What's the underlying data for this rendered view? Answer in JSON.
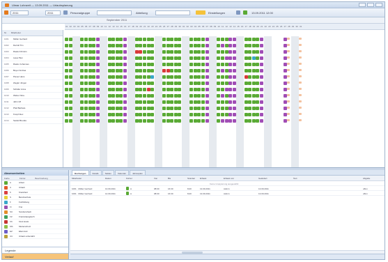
{
  "window": {
    "title": "Ulmar Lohnzeit — 13.09.2011 — Urlaubsplanung",
    "controls": [
      "minimize",
      "maximize",
      "close"
    ]
  },
  "toolbar": {
    "year_value": "2011",
    "period_value": "2011",
    "group_label": "Personalgruppe",
    "group_value": "",
    "view_label": "Abteilung",
    "view_value": "",
    "filter_label": "Einstellungen",
    "info_text": "13.09.2011 12:00"
  },
  "grid": {
    "header_date": "September 2011",
    "name_header": [
      "Nr.",
      "Mitarbeiter"
    ],
    "employees": [
      {
        "id": "1001",
        "name": "Müller Gerhard"
      },
      {
        "id": "1002",
        "name": "Darroll Tim"
      },
      {
        "id": "1003",
        "name": "Riedel Christin"
      },
      {
        "id": "1004",
        "name": "Lauer Ben"
      },
      {
        "id": "1005",
        "name": "Rieder Johannes"
      },
      {
        "id": "1006",
        "name": "Beyer Andrea"
      },
      {
        "id": "1007",
        "name": "Pieser Hans"
      },
      {
        "id": "1008",
        "name": "Ziegler Jürgen"
      },
      {
        "id": "1009",
        "name": "Schäfer Anna"
      },
      {
        "id": "1010",
        "name": "Weber Nina"
      },
      {
        "id": "1011",
        "name": "Jahn Ulf"
      },
      {
        "id": "1012",
        "name": "Pfeil Barbara"
      },
      {
        "id": "1013",
        "name": "Knopf Alex"
      },
      {
        "id": "1014",
        "name": "Seidel Brenda"
      }
    ],
    "day_numbers": [
      "01",
      "02",
      "03",
      "04",
      "05",
      "06",
      "07",
      "08",
      "09",
      "10",
      "11",
      "12",
      "13",
      "14",
      "15",
      "16",
      "17",
      "18",
      "19",
      "20",
      "21",
      "22",
      "23",
      "24",
      "25",
      "26",
      "27",
      "28",
      "29",
      "30",
      "01",
      "02",
      "03",
      "04",
      "05",
      "06",
      "07",
      "08",
      "09",
      "10",
      "11",
      "12",
      "13",
      "14",
      "15",
      "16",
      "17",
      "18",
      "19",
      "20",
      "21",
      "22",
      "23",
      "24",
      "25",
      "26",
      "27",
      "28",
      "29",
      "30",
      "31"
    ]
  },
  "legend": {
    "title": "Abwesenheiten",
    "header": [
      "Farbe",
      "Kürzel",
      "Beschreibung"
    ],
    "items": [
      {
        "color": "#5aaa35",
        "code": "A",
        "desc": "Arbeit"
      },
      {
        "color": "#e25a2a",
        "code": "U",
        "desc": "Urlaub"
      },
      {
        "color": "#d94040",
        "code": "K",
        "desc": "Krankheit"
      },
      {
        "color": "#e8d23a",
        "code": "S",
        "desc": "Berufsschule"
      },
      {
        "color": "#38a7c9",
        "code": "F",
        "desc": "Fortbildung"
      },
      {
        "color": "#9a4fb0",
        "code": "Fr",
        "desc": "Frei"
      },
      {
        "color": "#e38d2a",
        "code": "SU",
        "desc": "Sonderurlaub"
      },
      {
        "color": "#3fa05c",
        "code": "FZ",
        "desc": "Freizeitausgleich"
      },
      {
        "color": "#c73333",
        "code": "KK",
        "desc": "Kind krank"
      },
      {
        "color": "#8fbf4a",
        "code": "MS",
        "desc": "Mutterschutz"
      },
      {
        "color": "#6c5cc7",
        "code": "EZ",
        "desc": "Elternzeit"
      },
      {
        "color": "#b9a03a",
        "code": "UU",
        "desc": "Urlaub unbezahlt"
      }
    ],
    "bottom_1": "Legende",
    "bottom_2": "Verlauf"
  },
  "detail": {
    "tabs": [
      "Buchungen",
      "Details",
      "Salden",
      "Kalender",
      "Jahresplan"
    ],
    "columns": [
      "Mitarbeiter",
      "Datum",
      "Kürzel",
      "Von",
      "Bis",
      "Stunden",
      "Erfasst",
      "Erfasst von",
      "Geändert",
      "Text",
      "Abgabe"
    ],
    "group_note": "Keine Gruppierung ausgewählt",
    "rows": [
      {
        "emp": "1001 · Müller Gerhard",
        "date": "13.09.2011",
        "code": "A",
        "from": "08:00",
        "to": "16:30",
        "hours": "8,00",
        "cap": "13.09.2011",
        "by": "Admin",
        "chg": "13.09.2011",
        "txt": "",
        "stat": "offen"
      },
      {
        "emp": "1001 · Müller Gerhard",
        "date": "14.09.2011",
        "code": "A",
        "from": "08:00",
        "to": "16:30",
        "hours": "8,00",
        "cap": "13.09.2011",
        "by": "Admin",
        "chg": "13.09.2011",
        "txt": "",
        "stat": "offen"
      }
    ]
  },
  "colors": {
    "work": "#5aaa35",
    "free": "#a04db5",
    "sick": "#d93a3a",
    "vacation": "#e4602a",
    "training": "#3aa8c8",
    "school": "#e8d23a",
    "holiday_plan": "#f3c2a0"
  }
}
